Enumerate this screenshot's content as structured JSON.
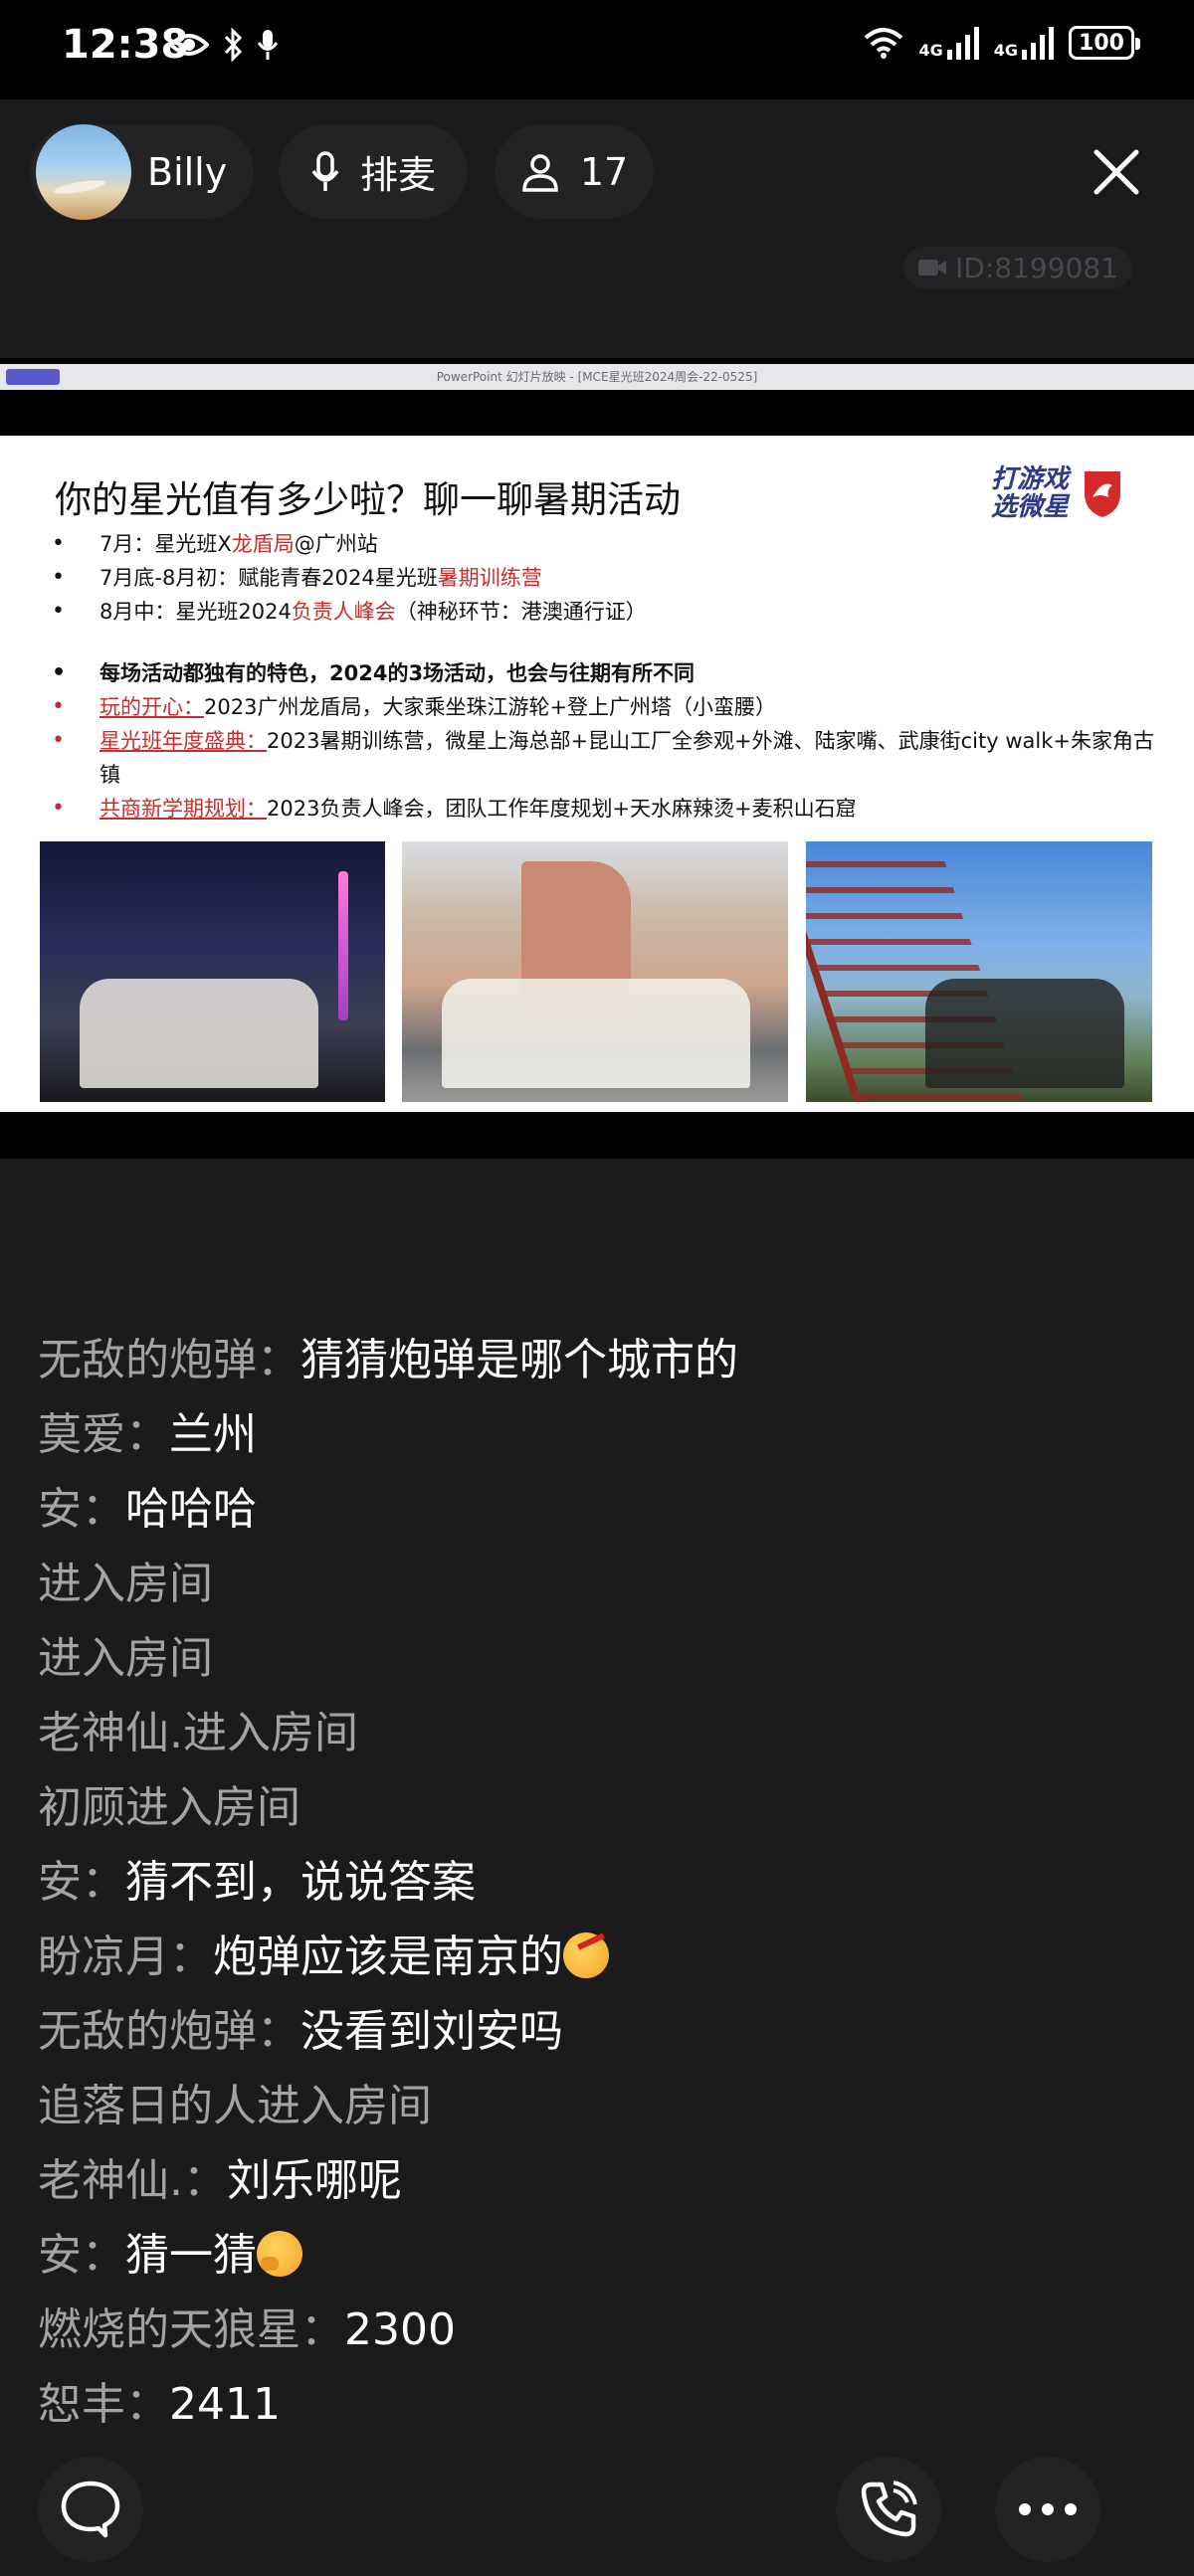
{
  "status_bar": {
    "time": "12:38",
    "net_1": "4G",
    "net_2": "4G",
    "battery": "100",
    "icons": [
      "eye-icon",
      "bluetooth-icon",
      "mic-icon",
      "wifi-icon",
      "signal-icon",
      "battery-icon"
    ]
  },
  "header": {
    "host_name": "Billy",
    "queue_label": "排麦",
    "viewer_count": "17",
    "room_id": "ID:8199081"
  },
  "shared_screen": {
    "ppt_title": "PowerPoint 幻灯片放映 - [MCE星光班2024周会-22-0525]",
    "slide_title": "你的星光值有多少啦？聊一聊暑期活动",
    "brand_line1": "打游戏",
    "brand_line2": "选微星",
    "bullets_a": [
      {
        "pre": "7月：星光班X",
        "hl": "龙盾局",
        "post": "@广州站"
      },
      {
        "pre": "7月底-8月初：赋能青春2024星光班",
        "hl": "暑期训练营",
        "post": ""
      },
      {
        "pre": "8月中：星光班2024",
        "hl": "负责人峰会",
        "post": "（神秘环节：港澳通行证）"
      }
    ],
    "bullet_b_head": "每场活动都独有的特色，2024的3场活动，也会与往期有所不同",
    "bullets_b": [
      {
        "label": "玩的开心：",
        "text": "2023广州龙盾局，大家乘坐珠江游轮+登上广州塔（小蛮腰）"
      },
      {
        "label": "星光班年度盛典：",
        "text": "2023暑期训练营，微星上海总部+昆山工厂全参观+外滩、陆家嘴、武康街city walk+朱家角古镇"
      },
      {
        "label": "共商新学期规划：",
        "text": "2023负责人峰会，团队工作年度规划+天水麻辣烫+麦积山石窟"
      }
    ]
  },
  "chat": [
    {
      "nick": "无敌的炮弹：",
      "text": "猜猜炮弹是哪个城市的"
    },
    {
      "nick": "莫爱：",
      "text": "兰州"
    },
    {
      "nick": "安：",
      "text": "哈哈哈"
    },
    {
      "nick": "",
      "text": "",
      "system": "进入房间"
    },
    {
      "nick": "",
      "text": "",
      "system": "进入房间"
    },
    {
      "nick": "",
      "text": "",
      "system": "老神仙.进入房间"
    },
    {
      "nick": "",
      "text": "",
      "system": "初顾进入房间"
    },
    {
      "nick": "安：",
      "text": "猜不到，说说答案"
    },
    {
      "nick": "盼凉月：",
      "text": "炮弹应该是南京的"
    },
    {
      "nick": "无敌的炮弹：",
      "text": "没看到刘安吗"
    },
    {
      "nick": "",
      "text": "",
      "system": "追落日的人进入房间"
    },
    {
      "nick": "老神仙.：",
      "text": "刘乐哪呢"
    },
    {
      "nick": "安：",
      "text": "猜一猜"
    },
    {
      "nick": "燃烧的天狼星：",
      "text": "2300"
    },
    {
      "nick": "恕丰：",
      "text": "2411"
    }
  ],
  "colors": {
    "background": "#1b1b1d",
    "pill": "#232325",
    "nick": "#a3a3a6",
    "slide_red": "#c62d2d"
  }
}
